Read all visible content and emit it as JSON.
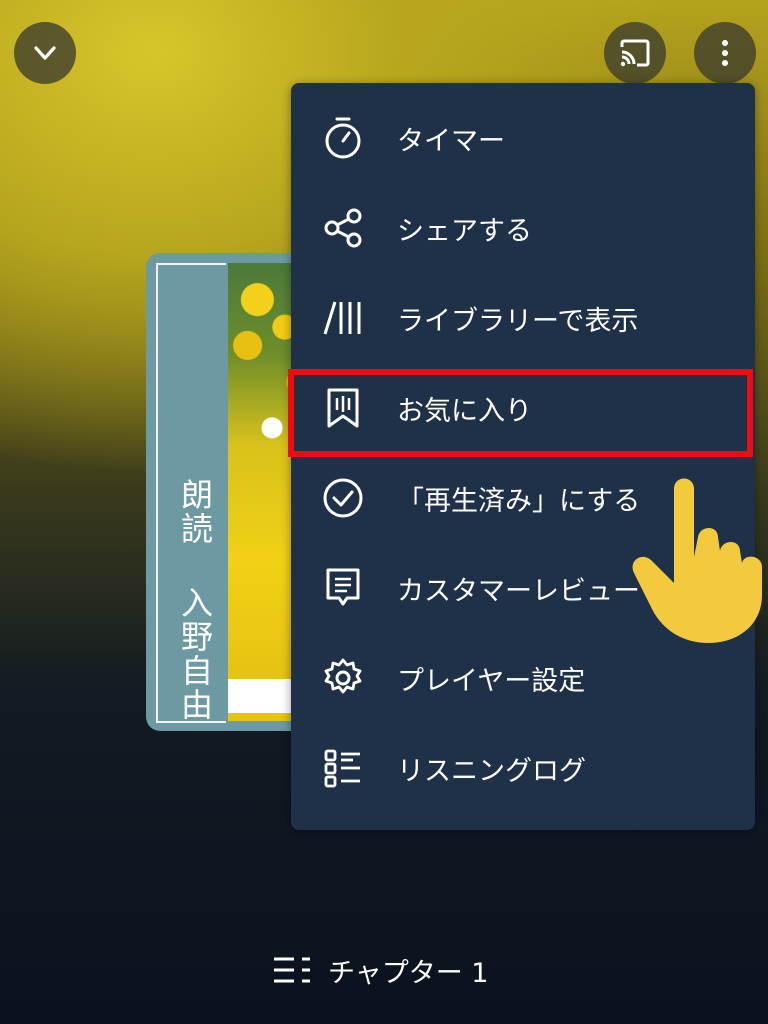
{
  "cover": {
    "narration_text": "朗読 入野自由"
  },
  "menu": {
    "items": [
      {
        "label": "タイマー",
        "icon": "timer-icon"
      },
      {
        "label": "シェアする",
        "icon": "share-icon"
      },
      {
        "label": "ライブラリーで表示",
        "icon": "library-icon"
      },
      {
        "label": "お気に入り",
        "icon": "favorite-bookmark-icon"
      },
      {
        "label": "「再生済み」にする",
        "icon": "check-circle-icon"
      },
      {
        "label": "カスタマーレビュー",
        "icon": "review-icon"
      },
      {
        "label": "プレイヤー設定",
        "icon": "gear-icon"
      },
      {
        "label": "リスニングログ",
        "icon": "listening-log-icon"
      }
    ]
  },
  "chapter": {
    "label": "チャプター 1"
  },
  "colors": {
    "menu_bg": "#1f3049",
    "highlight": "#ec0d12",
    "hand": "#f3c93e"
  }
}
